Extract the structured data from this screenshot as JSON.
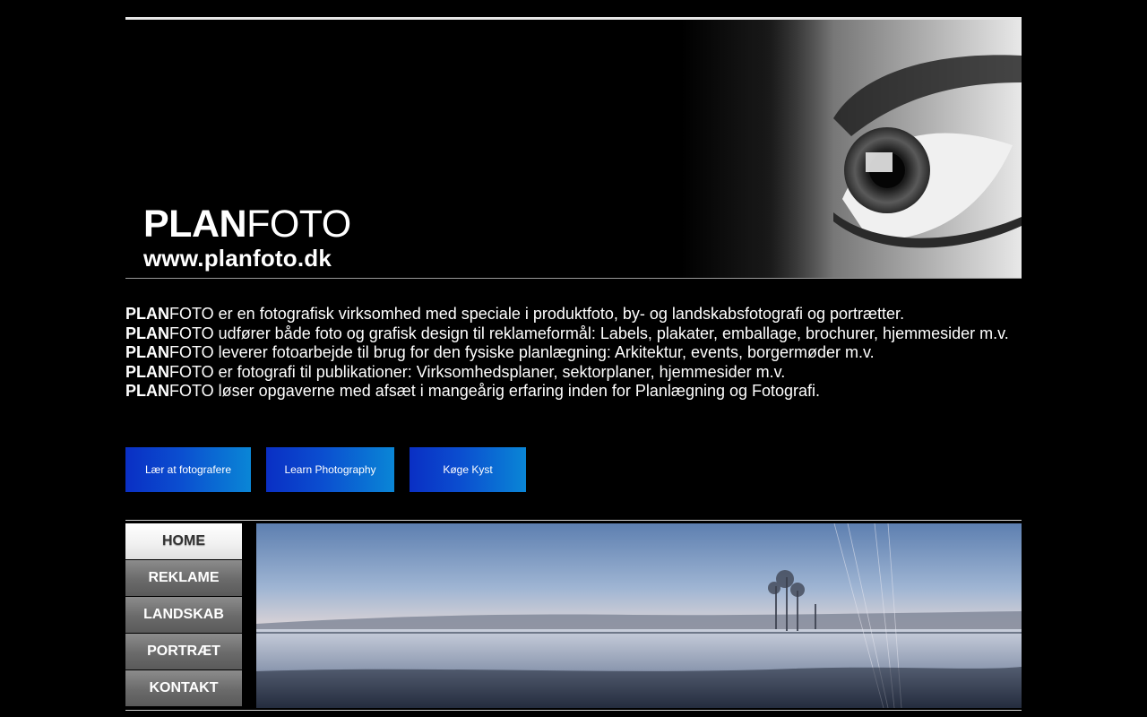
{
  "brand": {
    "name_bold": "PLAN",
    "name_light": "FOTO",
    "url": "www.planfoto.dk"
  },
  "intro": {
    "lines": [
      {
        "prefix": "PLAN",
        "text": "FOTO er en fotografisk virksomhed med speciale i produktfoto, by- og landskabsfotografi og portrætter."
      },
      {
        "prefix": "PLAN",
        "text": "FOTO udfører både foto og grafisk design til reklameformål: Labels, plakater, emballage, brochurer, hjemmesider m.v."
      },
      {
        "prefix": "PLAN",
        "text": "FOTO leverer fotoarbejde til brug for den fysiske planlægning: Arkitektur, events, borgermøder m.v."
      },
      {
        "prefix": "PLAN",
        "text": "FOTO er fotografi til publikationer: Virksomhedsplaner, sektorplaner, hjemmesider m.v."
      },
      {
        "prefix": "PLAN",
        "text": "FOTO løser opgaverne med afsæt i mangeårig erfaring inden for Planlægning og Fotografi."
      }
    ]
  },
  "buttons": [
    {
      "label": "Lær at fotografere"
    },
    {
      "label": "Learn Photography"
    },
    {
      "label": "Køge Kyst"
    }
  ],
  "nav": [
    {
      "label": "HOME",
      "active": true
    },
    {
      "label": "REKLAME"
    },
    {
      "label": "LANDSKAB"
    },
    {
      "label": "PORTRÆT"
    },
    {
      "label": "KONTAKT"
    }
  ],
  "colors": {
    "button_start": "#0a2fc4",
    "button_end": "#0a86d6",
    "background": "#000000"
  }
}
